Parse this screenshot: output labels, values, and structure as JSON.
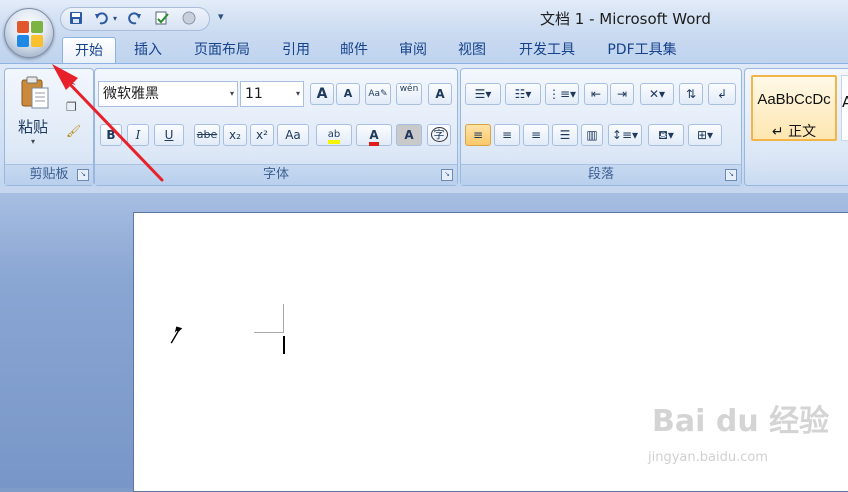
{
  "window": {
    "title": "文档 1 - Microsoft Word"
  },
  "quick_access": {
    "items": [
      {
        "icon": "save-icon"
      },
      {
        "icon": "undo-icon"
      },
      {
        "icon": "redo-icon"
      },
      {
        "icon": "spelling-icon"
      },
      {
        "icon": "circle-icon"
      }
    ],
    "more_glyph": "▾"
  },
  "tabs": [
    {
      "label": "开始",
      "active": true
    },
    {
      "label": "插入"
    },
    {
      "label": "页面布局"
    },
    {
      "label": "引用"
    },
    {
      "label": "邮件"
    },
    {
      "label": "审阅"
    },
    {
      "label": "视图"
    },
    {
      "label": "开发工具"
    },
    {
      "label": "PDF工具集"
    }
  ],
  "ribbon": {
    "clipboard": {
      "label": "剪贴板",
      "paste_label": "粘贴"
    },
    "font": {
      "label": "字体",
      "font_name": "微软雅黑",
      "font_size": "11",
      "buttons": {
        "bold": "B",
        "italic": "I",
        "underline": "U",
        "strikethrough": "abe",
        "subscript": "x₂",
        "superscript": "x²",
        "change_case": "Aa",
        "grow": "A",
        "shrink": "A",
        "phonetic": "ab",
        "encircle": "wén",
        "border": "A",
        "highlight": "ab",
        "color": "A",
        "shade": "A",
        "enclose": "字"
      }
    },
    "paragraph": {
      "label": "段落"
    },
    "styles": {
      "normal_sample": "AaBbCcDc",
      "normal_name": "↵ 正文",
      "next_sample": "A"
    }
  },
  "watermark": {
    "brand": "Bai du 经验",
    "url": "jingyan.baidu.com"
  }
}
